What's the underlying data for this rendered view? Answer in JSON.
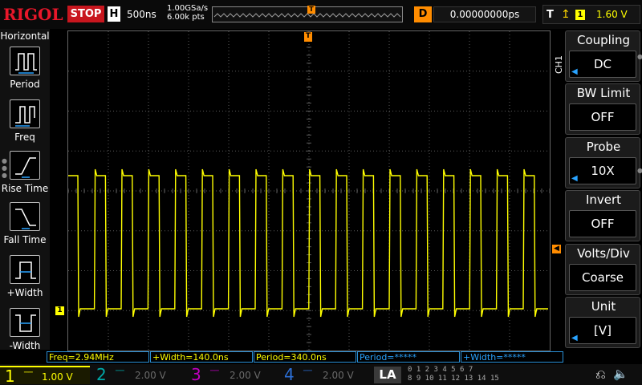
{
  "topbar": {
    "brand": "RIGOL",
    "run_state": "STOP",
    "horizontal_label": "H",
    "timebase": "500ns",
    "sample_rate": "1.00GSa/s",
    "memory_depth": "6.00k pts",
    "memory_trigger_marker": "T",
    "delay_label": "D",
    "delay_value": "0.00000000ps",
    "trigger_label": "T",
    "trigger_source": "1",
    "trigger_level": "1.60 V"
  },
  "left_panel": {
    "title": "Horizontal",
    "items": [
      {
        "label": "Period",
        "icon": "period-icon"
      },
      {
        "label": "Freq",
        "icon": "frequency-icon"
      },
      {
        "label": "Rise Time",
        "icon": "rise-time-icon"
      },
      {
        "label": "Fall Time",
        "icon": "fall-time-icon"
      },
      {
        "label": "+Width",
        "icon": "positive-width-icon"
      },
      {
        "label": "-Width",
        "icon": "negative-width-icon"
      }
    ]
  },
  "display": {
    "trigger_marker": "T",
    "channel_marker": "1",
    "channel_side_label": "CH1",
    "waveform": {
      "channel": "1",
      "color": "#ffff00",
      "period": "340.0ns",
      "positive_width": "140.0ns"
    },
    "grid_color": "#5a5a5a",
    "trace_color": "#ffff00"
  },
  "right_menu": {
    "items": [
      {
        "title": "Coupling",
        "value": "DC",
        "has_arrow": true
      },
      {
        "title": "BW Limit",
        "value": "OFF",
        "has_arrow": false
      },
      {
        "title": "Probe",
        "value": "10X",
        "has_arrow": true
      },
      {
        "title": "Invert",
        "value": "OFF",
        "has_arrow": false
      },
      {
        "title": "Volts/Div",
        "value": "Coarse",
        "has_arrow": false
      },
      {
        "title": "Unit",
        "value": "[V]",
        "has_arrow": true
      }
    ]
  },
  "measurements": [
    {
      "text": "Freq=2.94MHz",
      "color": "yellow"
    },
    {
      "text": "+Width=140.0ns",
      "color": "yellow"
    },
    {
      "text": "Period=340.0ns",
      "color": "yellow"
    },
    {
      "text": "Period=*****",
      "color": "blue"
    },
    {
      "text": "+Width=*****",
      "color": "blue"
    }
  ],
  "channels": [
    {
      "num": "1",
      "scale": "1.00 V",
      "color": "#ffff00",
      "active": true
    },
    {
      "num": "2",
      "scale": "2.00 V",
      "color": "#00a8a8",
      "active": false
    },
    {
      "num": "3",
      "scale": "2.00 V",
      "color": "#c000c0",
      "active": false
    },
    {
      "num": "4",
      "scale": "2.00 V",
      "color": "#2c6fd6",
      "active": false
    }
  ],
  "bottom": {
    "la_label": "LA",
    "digital_row1": "0 1 2 3   4 5 6 7",
    "digital_row2": "8 9 10 11 12 13 14 15",
    "usb_icon": "usb-icon",
    "speaker_icon": "speaker-icon"
  }
}
